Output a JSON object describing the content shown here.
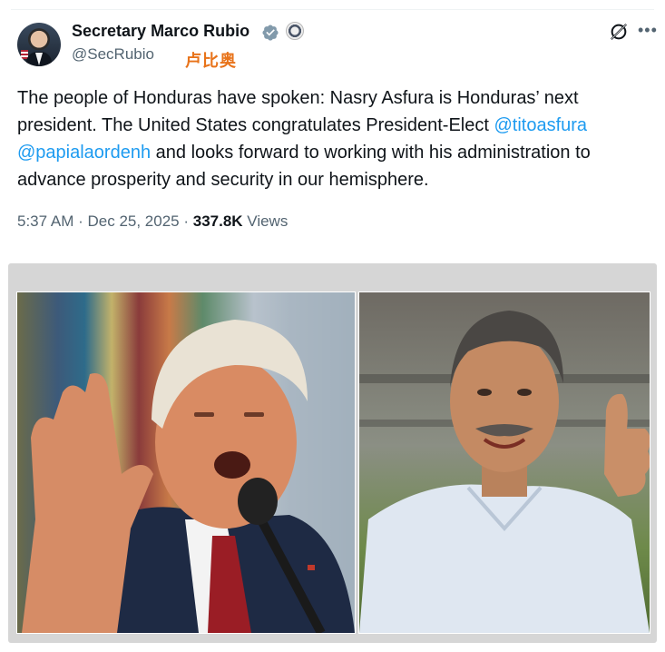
{
  "author": {
    "name": "Secretary Marco Rubio",
    "handle": "@SecRubio",
    "annotation": "卢比奥"
  },
  "tweet": {
    "text_1": "The people of Honduras have spoken: Nasry Asfura is Honduras’ next president. The United States congratulates President-Elect ",
    "mention_1": "@titoasfura",
    "mention_2": "@papialaordenh",
    "text_2": " and looks forward to working with his administration to advance prosperity and security in our hemisphere."
  },
  "meta": {
    "time": "5:37 AM",
    "sep1": " · ",
    "date": "Dec 25, 2025",
    "sep2": " · ",
    "views_count": "337.8K",
    "views_label": " Views"
  },
  "icons": {
    "verified": "verified-badge-icon",
    "affiliation": "state-department-seal-icon",
    "grok": "grok-icon",
    "more": "more-options-icon"
  },
  "colors": {
    "link": "#1d9bf0",
    "muted": "#536471",
    "annotation": "#e8731a",
    "verified_badge": "#829aab"
  }
}
